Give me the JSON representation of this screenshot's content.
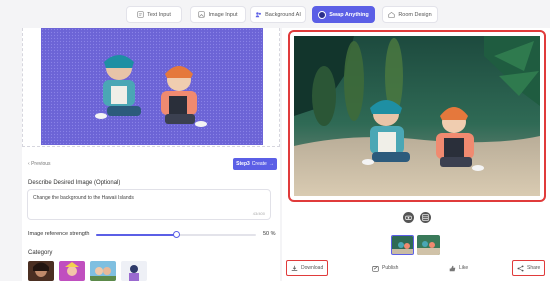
{
  "tabs": [
    {
      "label": "Text Input",
      "icon": "text-icon",
      "active": false
    },
    {
      "label": "Image Input",
      "icon": "image-icon",
      "active": false
    },
    {
      "label": "Background AI",
      "icon": "people-icon",
      "active": false
    },
    {
      "label": "Swap Anything",
      "icon": "swap-icon",
      "active": true
    },
    {
      "label": "Room Design",
      "icon": "room-icon",
      "active": false
    }
  ],
  "editor": {
    "back_label": "Previous",
    "create_step": "Step3",
    "create_label": "Create",
    "describe_label": "Describe Desired Image (Optional)",
    "prompt_value": "Change the background to the Hawaii Islands",
    "prompt_count": "43/400",
    "strength_label": "Image reference strength",
    "strength_value": "50 %",
    "strength_fraction": 0.5,
    "category_label": "Category"
  },
  "result": {
    "actions": {
      "download": "Download",
      "publish": "Publish",
      "like": "Like",
      "share": "Share"
    }
  },
  "colors": {
    "accent": "#5b5fe6",
    "highlight": "#e03b3b"
  }
}
